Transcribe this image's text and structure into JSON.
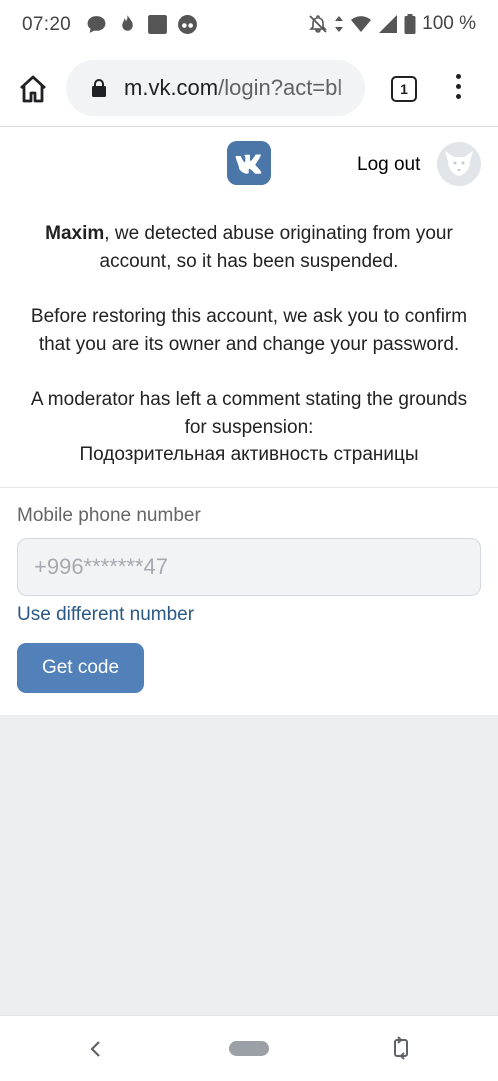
{
  "status_bar": {
    "time": "07:20",
    "notification_icons": [
      "chat-bubble-icon",
      "fire-icon",
      "square-app-icon",
      "cat-face-icon"
    ],
    "system_icons": [
      "bell-off-icon",
      "data-arrows-icon",
      "wifi-icon",
      "signal-icon",
      "battery-icon"
    ],
    "battery": "100 %"
  },
  "browser": {
    "url_host": "m.vk.com",
    "url_path": "/login?act=bl",
    "tab_count": "1"
  },
  "header": {
    "logout": "Log out"
  },
  "message": {
    "name": "Maxim",
    "line1_rest": ", we detected abuse originating from your account, so it has been suspended.",
    "line2": "Before restoring this account, we ask you to confirm that you are its owner and change your password.",
    "line3": "A moderator has left a comment stating the grounds for suspension:",
    "comment": "Подозрительная активность страницы"
  },
  "form": {
    "label": "Mobile phone number",
    "phone_placeholder": "+996*******47",
    "different_number": "Use different number",
    "get_code": "Get code"
  },
  "colors": {
    "vk_blue": "#4a76a8",
    "button_blue": "#5181b8",
    "link_blue": "#2a5885"
  }
}
